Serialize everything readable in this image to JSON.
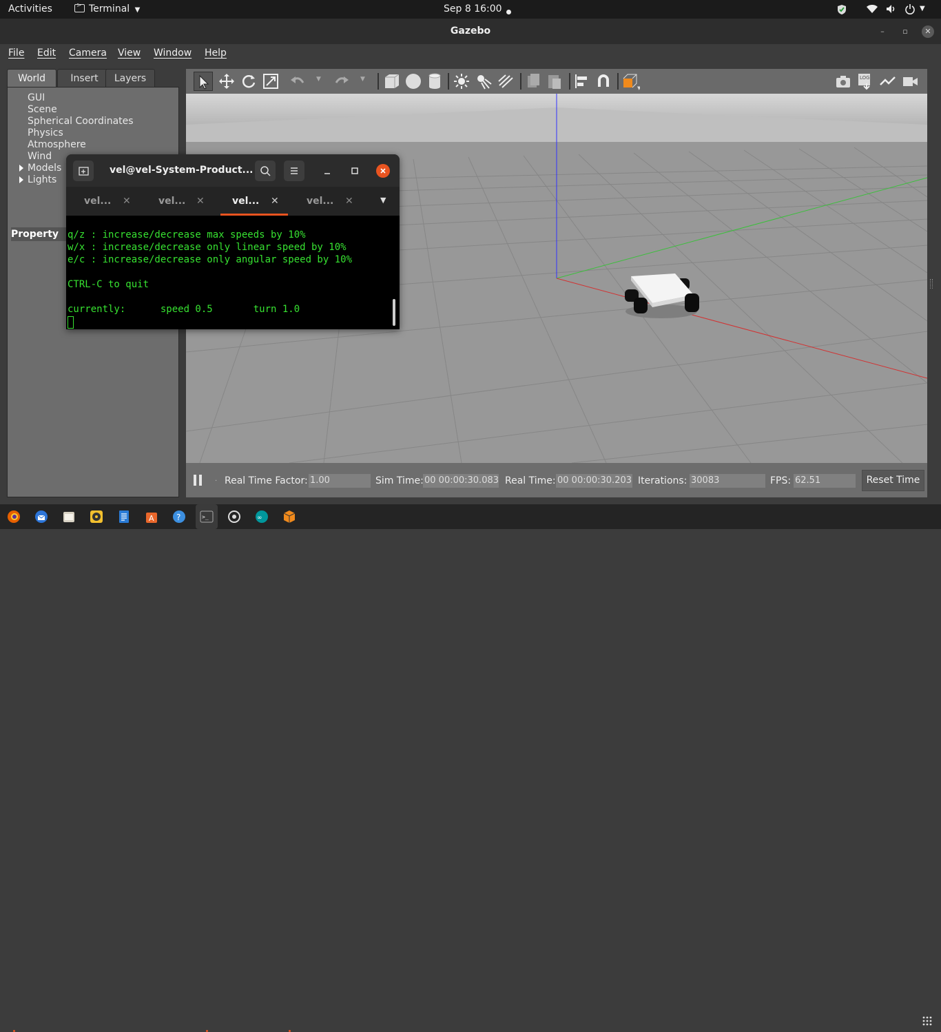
{
  "topbar": {
    "activities": "Activities",
    "app_menu": "Terminal",
    "clock": "Sep 8  16:00"
  },
  "gazebo": {
    "title": "Gazebo",
    "menu": [
      "File",
      "Edit",
      "Camera",
      "View",
      "Window",
      "Help"
    ],
    "tabs": [
      "World",
      "Insert",
      "Layers"
    ],
    "tree": [
      "GUI",
      "Scene",
      "Spherical Coordinates",
      "Physics",
      "Atmosphere",
      "Wind",
      "Models",
      "Lights"
    ],
    "property_label": "Property",
    "status": {
      "rtf_label": "Real Time Factor:",
      "rtf_value": "1.00",
      "sim_label": "Sim Time:",
      "sim_value": "00 00:00:30.083",
      "real_label": "Real Time:",
      "real_value": "00 00:00:30.203",
      "iter_label": "Iterations:",
      "iter_value": "30083",
      "fps_label": "FPS:",
      "fps_value": "62.51",
      "reset_label": "Reset Time"
    }
  },
  "terminal": {
    "title": "vel@vel-System-Product...",
    "tabs": [
      "vel...",
      "vel...",
      "vel...",
      "vel..."
    ],
    "active_tab": 2,
    "lines": [
      "q/z : increase/decrease max speeds by 10%",
      "w/x : increase/decrease only linear speed by 10%",
      "e/c : increase/decrease only angular speed by 10%",
      "",
      "CTRL-C to quit",
      "",
      "currently:      speed 0.5       turn 1.0"
    ],
    "text_color": "#37e231"
  },
  "colors": {
    "accent": "#e95420",
    "terminal_green": "#37e231"
  }
}
